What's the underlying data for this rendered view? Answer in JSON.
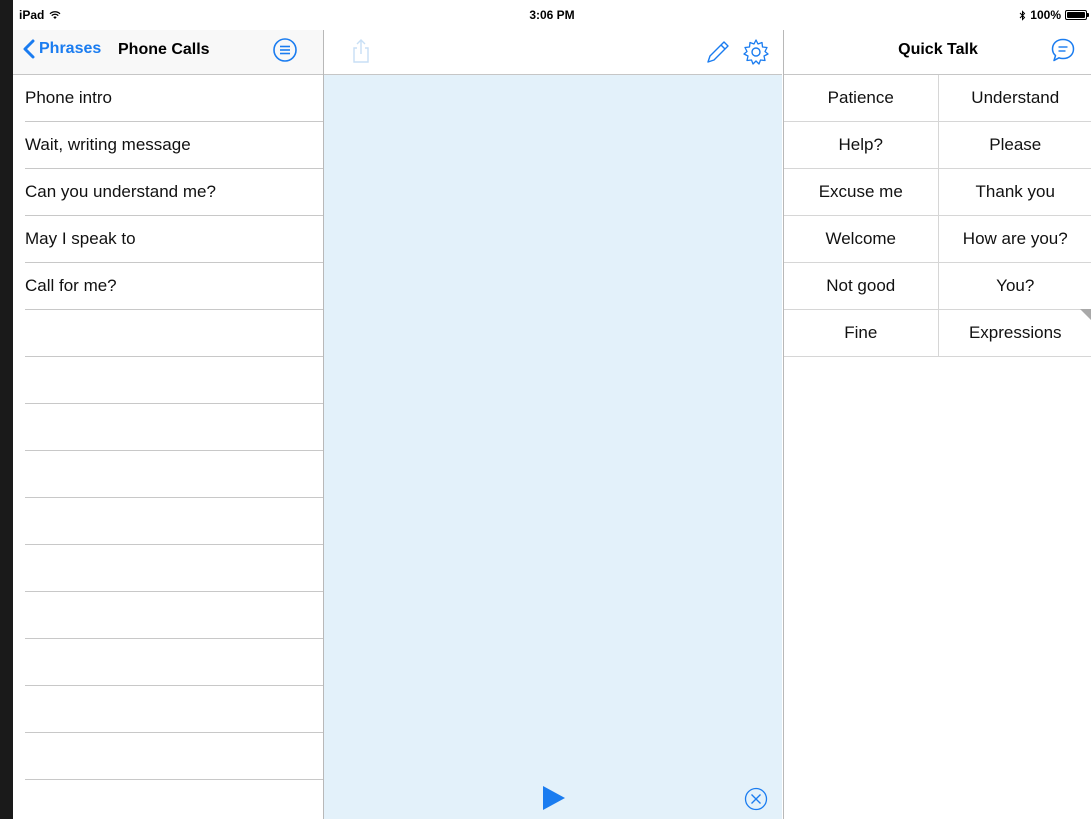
{
  "status_bar": {
    "device": "iPad",
    "time": "3:06 PM",
    "battery": "100%"
  },
  "phrases_panel": {
    "back_label": "Phrases",
    "title": "Phone Calls",
    "items": [
      {
        "label": "Phone intro"
      },
      {
        "label": "Wait, writing message"
      },
      {
        "label": "Can you understand me?"
      },
      {
        "label": "May I speak to"
      },
      {
        "label": "Call for me?"
      },
      {
        "label": ""
      },
      {
        "label": ""
      },
      {
        "label": ""
      },
      {
        "label": ""
      },
      {
        "label": ""
      },
      {
        "label": ""
      },
      {
        "label": ""
      },
      {
        "label": ""
      },
      {
        "label": ""
      },
      {
        "label": ""
      },
      {
        "label": ""
      }
    ]
  },
  "quick_talk": {
    "title": "Quick Talk",
    "rows": [
      [
        "Patience",
        "Understand"
      ],
      [
        "Help?",
        "Please"
      ],
      [
        "Excuse me",
        "Thank you"
      ],
      [
        "Welcome",
        "How are you?"
      ],
      [
        "Not good",
        "You?"
      ],
      [
        "Fine",
        "Expressions"
      ]
    ]
  },
  "colors": {
    "accent": "#1a7cf0",
    "compose_bg": "#e3f1fa"
  },
  "icons": {
    "back": "chevron-left-icon",
    "menu": "list-circle-icon",
    "share": "share-icon",
    "edit": "pencil-icon",
    "settings": "gear-icon",
    "chat": "speech-bubble-icon",
    "play": "play-icon",
    "clear": "clear-circle-icon"
  }
}
